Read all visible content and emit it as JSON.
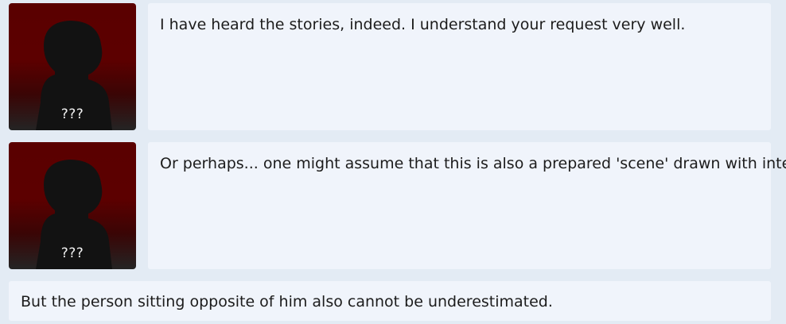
{
  "dialogue": [
    {
      "speaker": "???",
      "text": "I have heard the stories, indeed. I understand your request very well."
    },
    {
      "speaker": "???",
      "text": "Or perhaps... one might assume that this is also a prepared 'scene' drawn with intent."
    }
  ],
  "narration": {
    "text": "But the person sitting opposite of him also cannot be underestimated."
  },
  "colors": {
    "background": "#e3ebf4",
    "bubble": "#f0f4fb",
    "portrait_red": "#5a0000",
    "silhouette": "#111111"
  }
}
